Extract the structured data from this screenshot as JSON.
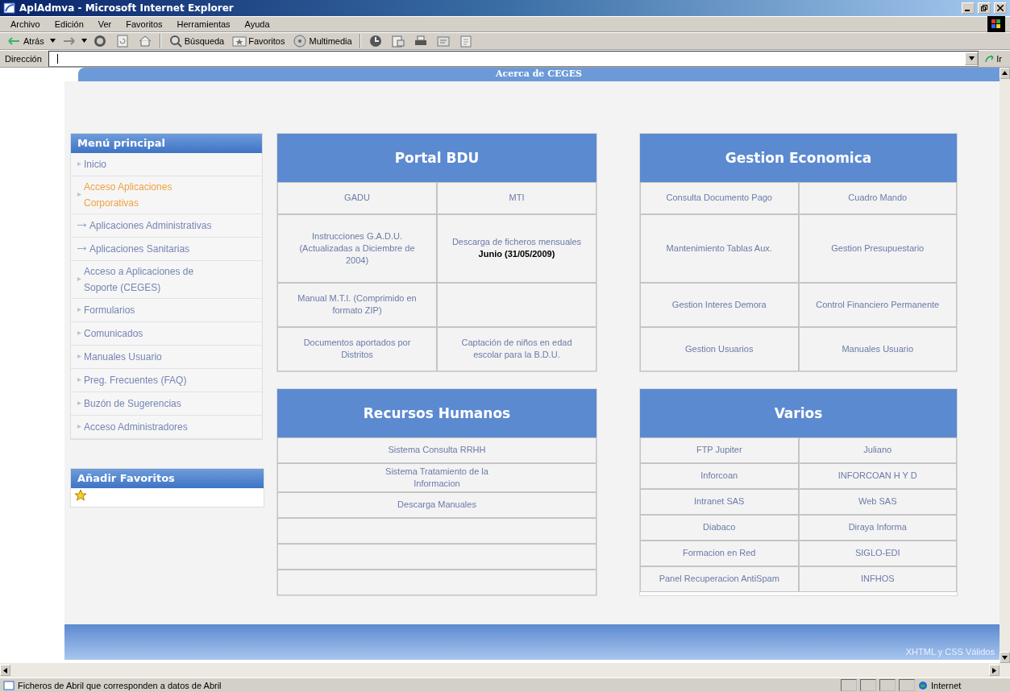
{
  "window": {
    "title": "AplAdmva - Microsoft Internet Explorer"
  },
  "menu_bar": [
    "Archivo",
    "Edición",
    "Ver",
    "Favoritos",
    "Herramientas",
    "Ayuda"
  ],
  "toolbar": [
    {
      "kind": "back",
      "label": "Atrás"
    },
    {
      "kind": "forward"
    },
    {
      "kind": "stop"
    },
    {
      "kind": "refresh"
    },
    {
      "kind": "home"
    },
    {
      "kind": "search",
      "label": "Búsqueda"
    },
    {
      "kind": "favorites",
      "label": "Favoritos"
    },
    {
      "kind": "media",
      "label": "Multimedia"
    },
    {
      "kind": "history"
    },
    {
      "kind": "mail"
    },
    {
      "kind": "print"
    },
    {
      "kind": "edit"
    },
    {
      "kind": "discuss"
    }
  ],
  "address_bar": {
    "label": "Dirección",
    "go": "Ir"
  },
  "page": {
    "top_bar": "Acerca de CEGES",
    "main_menu": {
      "title": "Menú principal",
      "items": [
        {
          "kind": "item",
          "label": "Inicio",
          "selected": false
        },
        {
          "kind": "item",
          "label": "Acceso Aplicaciones Corporativas",
          "selected": true
        },
        {
          "kind": "subitem",
          "label": "Aplicaciones Administrativas",
          "selected": false
        },
        {
          "kind": "subitem",
          "label": "Aplicaciones Sanitarias",
          "selected": false
        },
        {
          "kind": "item",
          "label": "Acceso a Aplicaciones de Soporte (CEGES)",
          "selected": false
        },
        {
          "kind": "item",
          "label": "Formularios",
          "selected": false
        },
        {
          "kind": "item",
          "label": "Comunicados",
          "selected": false
        },
        {
          "kind": "item",
          "label": "Manuales Usuario",
          "selected": false
        },
        {
          "kind": "item",
          "label": "Preg. Frecuentes (FAQ)",
          "selected": false
        },
        {
          "kind": "item",
          "label": "Buzón de Sugerencias",
          "selected": false
        },
        {
          "kind": "item",
          "label": "Acceso Administradores",
          "selected": false
        }
      ]
    },
    "favorites": {
      "title": "Añadir Favoritos"
    },
    "panels": [
      {
        "title": "Portal BDU",
        "rows": [
          [
            {
              "kind": "link",
              "text": "GADU"
            },
            {
              "kind": "link",
              "text": "MTI"
            }
          ],
          [
            {
              "kind": "link",
              "text": "Instrucciones G.A.D.U. (Actualizadas a Diciembre de 2004)"
            },
            {
              "kind": "link",
              "text": "Descarga de ficheros mensuales **Junio (31/05/2009)**"
            }
          ],
          [
            {
              "kind": "link",
              "text": "Manual M.T.I. (Comprimido en formato ZIP)"
            },
            {
              "kind": "empty"
            }
          ],
          [
            {
              "kind": "link",
              "text": "Documentos aportados por Distritos"
            },
            {
              "kind": "link",
              "text": "Captación de niños en edad escolar para la B.D.U."
            }
          ]
        ]
      },
      {
        "title": "Gestion Economica",
        "rows": [
          [
            {
              "kind": "link",
              "text": "Consulta Documento Pago"
            },
            {
              "kind": "link",
              "text": "Cuadro Mando"
            }
          ],
          [
            {
              "kind": "link",
              "text": "Mantenimiento Tablas Aux."
            },
            {
              "kind": "link",
              "text": "Gestion Presupuestario"
            }
          ],
          [
            {
              "kind": "link",
              "text": "Gestion Interes Demora"
            },
            {
              "kind": "link",
              "text": "Control Financiero Permanente"
            }
          ],
          [
            {
              "kind": "link",
              "text": "Gestion Usuarios"
            },
            {
              "kind": "link",
              "text": "Manuales Usuario"
            }
          ]
        ]
      },
      {
        "title": "Recursos Humanos",
        "rows": [
          [
            {
              "kind": "link",
              "text": "Sistema Consulta RRHH"
            }
          ],
          [
            {
              "kind": "link",
              "text": "Sistema Tratamiento de la Informacion"
            }
          ],
          [
            {
              "kind": "link",
              "text": "Descarga Manuales"
            }
          ],
          [
            {
              "kind": "empty"
            }
          ],
          [
            {
              "kind": "empty"
            }
          ],
          [
            {
              "kind": "empty"
            }
          ]
        ]
      },
      {
        "title": "Varios",
        "rows": [
          [
            {
              "kind": "link",
              "text": "FTP Jupiter"
            },
            {
              "kind": "link",
              "text": "Juliano"
            }
          ],
          [
            {
              "kind": "link",
              "text": "Inforcoan"
            },
            {
              "kind": "link",
              "text": "INFORCOAN H Y D"
            }
          ],
          [
            {
              "kind": "link",
              "text": "Intranet SAS"
            },
            {
              "kind": "link",
              "text": "Web SAS"
            }
          ],
          [
            {
              "kind": "link",
              "text": "Diabaco"
            },
            {
              "kind": "link",
              "text": "Diraya Informa"
            }
          ],
          [
            {
              "kind": "link",
              "text": "Formacion en Red"
            },
            {
              "kind": "link",
              "text": "SIGLO-EDI"
            }
          ],
          [
            {
              "kind": "link",
              "text": "Panel Recuperacion AntiSpam"
            },
            {
              "kind": "link",
              "text": "INFHOS"
            }
          ]
        ]
      }
    ],
    "footer": "XHTML y CSS Válidos"
  },
  "status_bar": {
    "text": "Ficheros de Abril que corresponden a datos de Abril",
    "zone": "Internet"
  }
}
